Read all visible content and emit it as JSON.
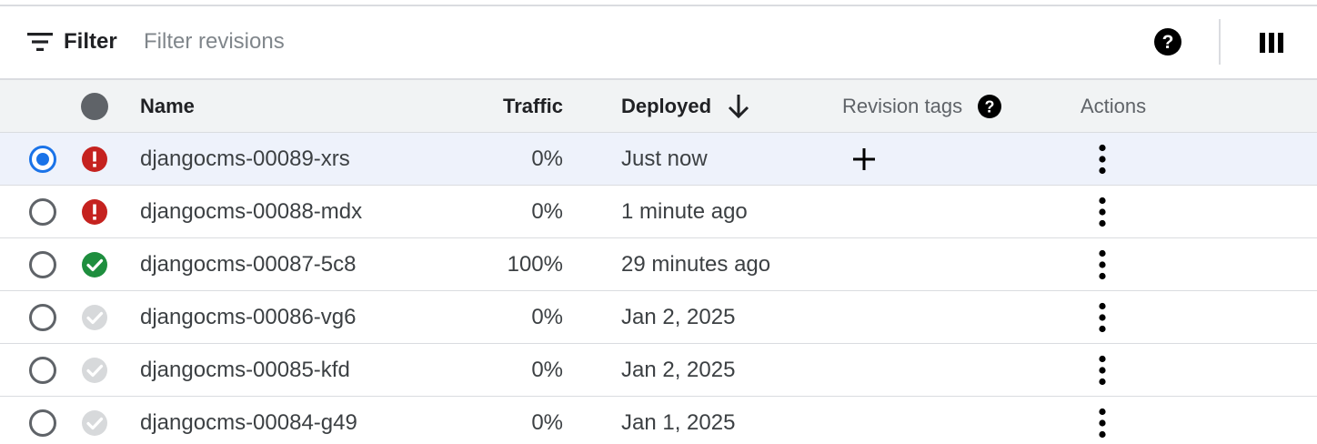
{
  "toolbar": {
    "filter_label": "Filter",
    "filter_placeholder": "Filter revisions",
    "filter_icon": "filter-list-icon",
    "help_icon": "help-icon",
    "columns_icon": "column-display-icon"
  },
  "table": {
    "headers": {
      "status_icon": "status-circle-icon",
      "name": "Name",
      "traffic": "Traffic",
      "deployed": "Deployed",
      "deployed_sort": "descending",
      "revision_tags": "Revision tags",
      "actions": "Actions"
    },
    "rows": [
      {
        "selected": true,
        "status": "error",
        "name": "djangocms-00089-xrs",
        "traffic": "0%",
        "deployed": "Just now"
      },
      {
        "selected": false,
        "status": "error",
        "name": "djangocms-00088-mdx",
        "traffic": "0%",
        "deployed": "1 minute ago"
      },
      {
        "selected": false,
        "status": "success",
        "name": "djangocms-00087-5c8",
        "traffic": "100%",
        "deployed": "29 minutes ago"
      },
      {
        "selected": false,
        "status": "inactive",
        "name": "djangocms-00086-vg6",
        "traffic": "0%",
        "deployed": "Jan 2, 2025"
      },
      {
        "selected": false,
        "status": "inactive",
        "name": "djangocms-00085-kfd",
        "traffic": "0%",
        "deployed": "Jan 2, 2025"
      },
      {
        "selected": false,
        "status": "inactive",
        "name": "djangocms-00084-g49",
        "traffic": "0%",
        "deployed": "Jan 1, 2025"
      }
    ]
  },
  "colors": {
    "selected_row": "#eef2fb",
    "radio_checked": "#1a73e8",
    "error": "#c5221f",
    "success": "#1e8e3e",
    "inactive": "#d7d9db",
    "header_bg": "#f1f3f4"
  }
}
